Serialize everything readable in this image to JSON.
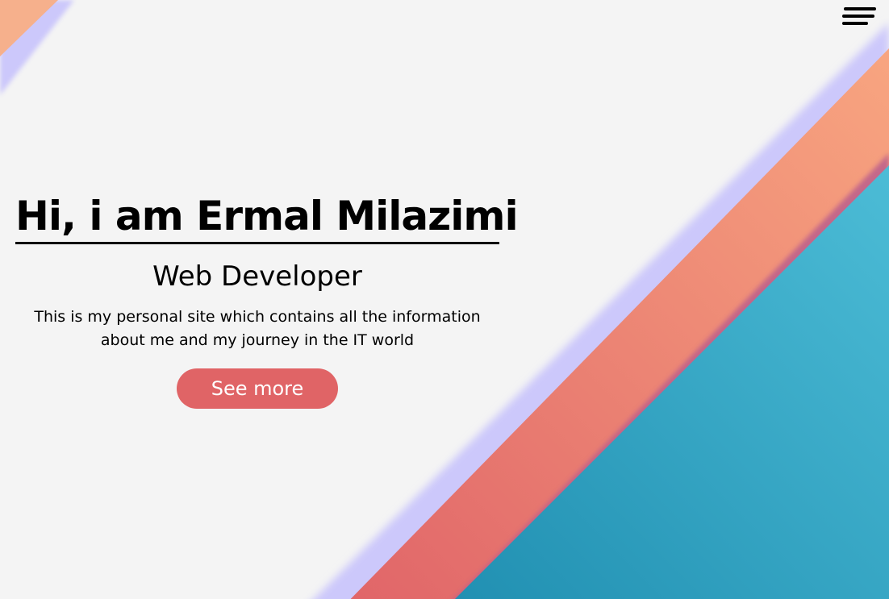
{
  "header": {
    "menu_icon": "hamburger-menu-icon"
  },
  "hero": {
    "title": "Hi, i am Ermal Milazimi",
    "subtitle": "Web Developer",
    "description": "This is my personal site which contains all the information about me and my journey in the IT world",
    "cta_label": "See more"
  },
  "colors": {
    "background": "#f4f4f4",
    "accent_button": "#e06466",
    "stripe_lavender": "#ccc8fb",
    "stripe_peach": "#f6a07f",
    "stripe_coral": "#e06868",
    "stripe_mauve": "#bf5e87",
    "teal_dark": "#2896b4",
    "teal_light": "#4abad4"
  }
}
